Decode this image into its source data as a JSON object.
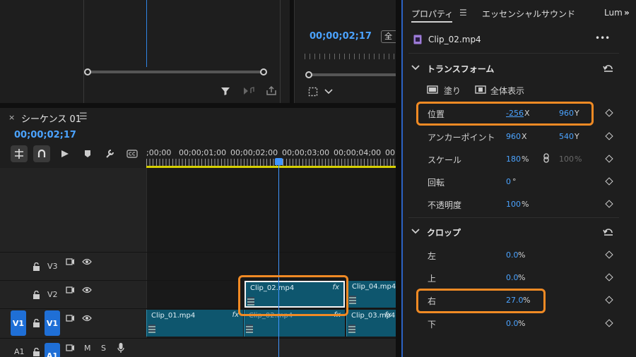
{
  "program": {
    "timecode": "00;00;02;17",
    "fit_label": "全"
  },
  "sequence": {
    "close": "×",
    "title": "シーケンス 01",
    "menu": "☰",
    "timecode": "00;00;02;17",
    "ruler_labels": [
      ";00;00",
      "00;00;01;00",
      "00;00;02;00",
      "00;00;03;00",
      "00;00;04;00",
      "00"
    ],
    "tracks": {
      "v3": "V3",
      "v2": "V2",
      "v1": "V1",
      "v1_src": "V1",
      "a1": "A1",
      "a1_src": "A1",
      "m": "M",
      "s": "S"
    },
    "clips": {
      "c02": {
        "name": "Clip_02.mp4",
        "fx": "fx"
      },
      "c04": {
        "name": "Clip_04.mp4",
        "fx": ""
      },
      "c01": {
        "name": "Clip_01.mp4",
        "fx": "fx"
      },
      "c02b": {
        "name": "Clip_02.mp4",
        "fx": "fx"
      },
      "c03": {
        "name": "Clip_03.mp4",
        "fx": "fx"
      }
    }
  },
  "properties": {
    "tab1": "プロパティ",
    "tab_menu": "☰",
    "tab2": "エッセンシャルサウンド",
    "tab3": "Lum",
    "more": "»",
    "clip_name": "Clip_02.mp4",
    "clip_more": "•••",
    "transform": {
      "title": "トランスフォーム",
      "fill_label": "塗り",
      "full_label": "全体表示",
      "position": {
        "label": "位置",
        "x": "-256",
        "x_unit": "X",
        "y": "960",
        "y_unit": "Y"
      },
      "anchor": {
        "label": "アンカーポイント",
        "x": "960",
        "x_unit": "X",
        "y": "540",
        "y_unit": "Y"
      },
      "scale": {
        "label": "スケール",
        "value": "180",
        "unit": "%",
        "value2": "100",
        "unit2": "%"
      },
      "rotation": {
        "label": "回転",
        "value": "0",
        "unit": "°"
      },
      "opacity": {
        "label": "不透明度",
        "value": "100",
        "unit": "%"
      }
    },
    "crop": {
      "title": "クロップ",
      "left": {
        "label": "左",
        "value": "0.0",
        "unit": "%"
      },
      "top": {
        "label": "上",
        "value": "0.0",
        "unit": "%"
      },
      "right": {
        "label": "右",
        "value": "27.0",
        "unit": "%"
      },
      "bottom": {
        "label": "下",
        "value": "0.0",
        "unit": "%"
      }
    }
  }
}
